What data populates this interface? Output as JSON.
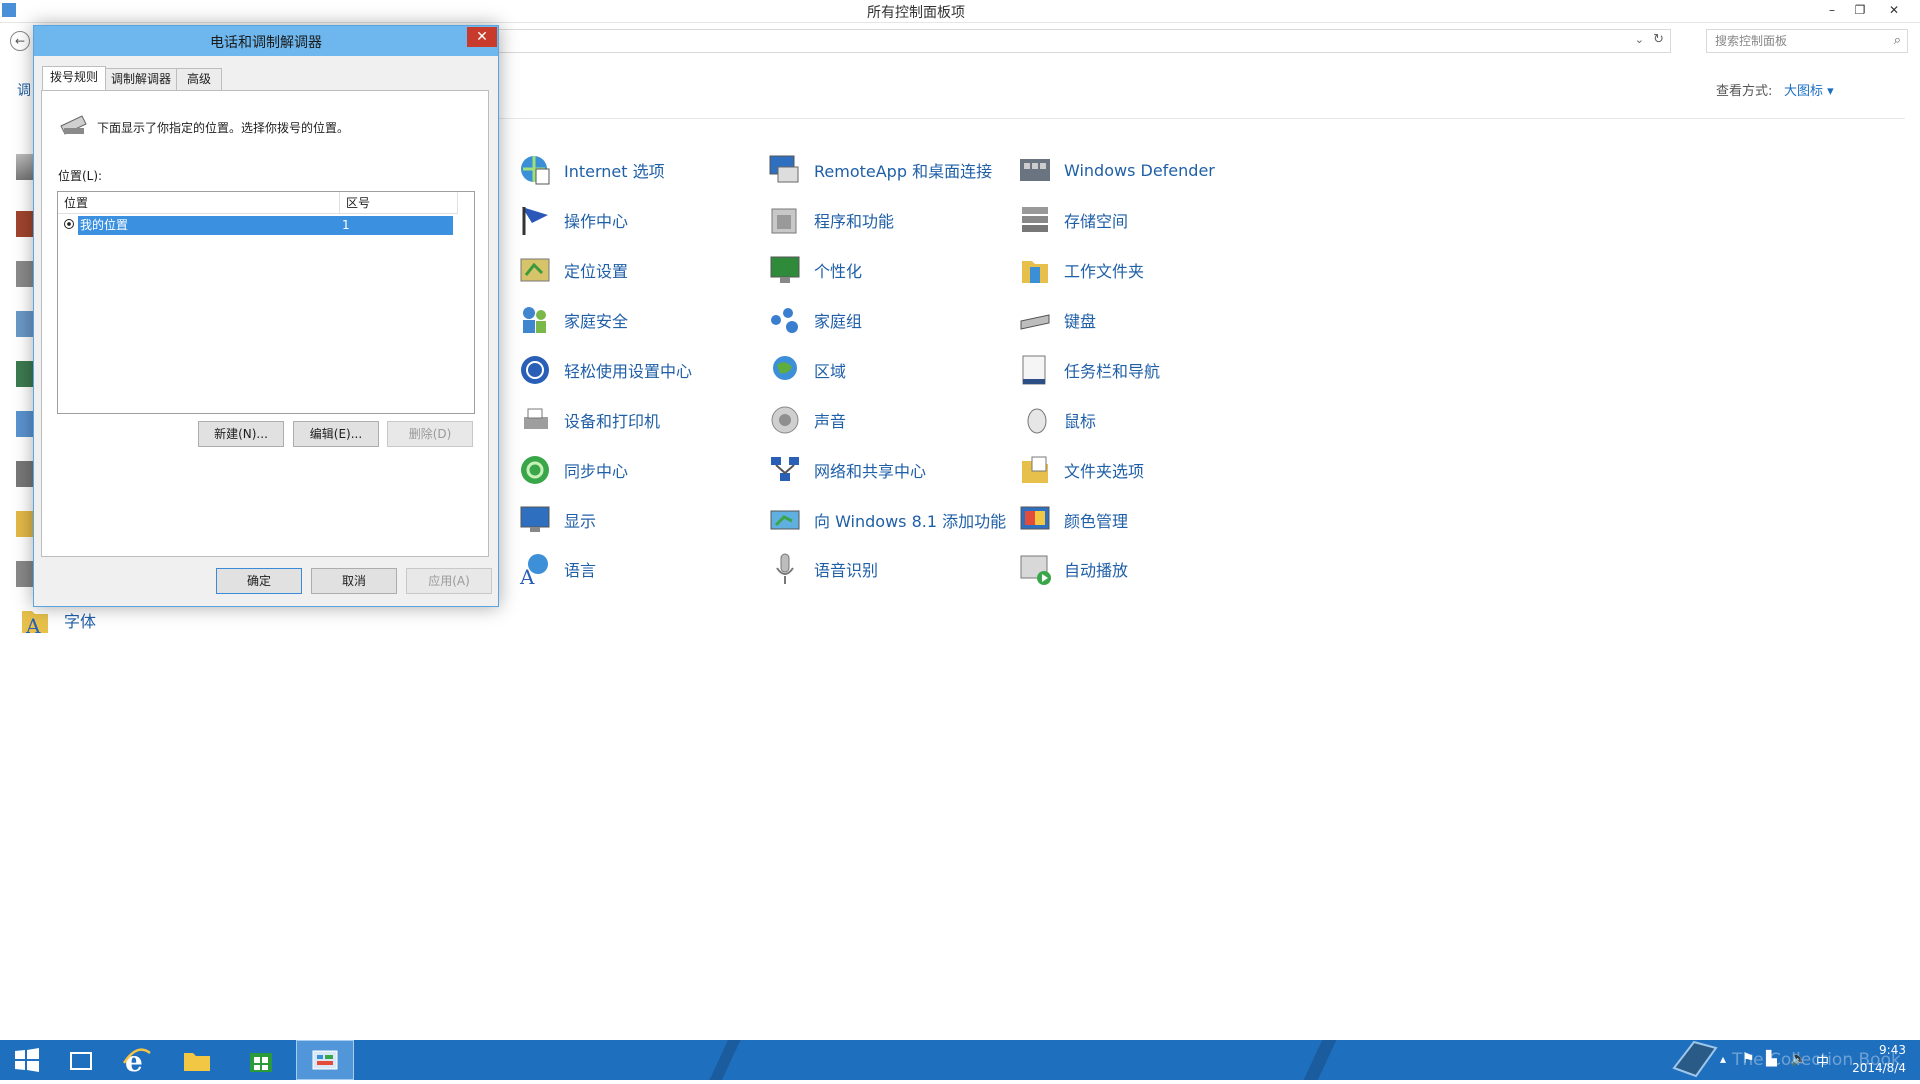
{
  "window": {
    "title": "所有控制面板项",
    "search_placeholder": "搜索控制面板",
    "left_partial_text": "调",
    "view_by_label": "查看方式:",
    "view_mode": "大图标 ▾"
  },
  "items": [
    {
      "label": "Internet 选项",
      "icon": "internet-options-icon"
    },
    {
      "label": "RemoteApp 和桌面连接",
      "icon": "remoteapp-icon"
    },
    {
      "label": "Windows Defender",
      "icon": "windows-defender-icon"
    },
    {
      "label": "操作中心",
      "icon": "action-center-flag-icon"
    },
    {
      "label": "程序和功能",
      "icon": "programs-features-icon"
    },
    {
      "label": "存储空间",
      "icon": "storage-spaces-icon"
    },
    {
      "label": "定位设置",
      "icon": "location-settings-icon"
    },
    {
      "label": "个性化",
      "icon": "personalization-icon"
    },
    {
      "label": "工作文件夹",
      "icon": "work-folders-icon"
    },
    {
      "label": "家庭安全",
      "icon": "family-safety-icon"
    },
    {
      "label": "家庭组",
      "icon": "homegroup-icon"
    },
    {
      "label": "键盘",
      "icon": "keyboard-icon"
    },
    {
      "label": "轻松使用设置中心",
      "icon": "ease-of-access-icon"
    },
    {
      "label": "区域",
      "icon": "region-icon"
    },
    {
      "label": "任务栏和导航",
      "icon": "taskbar-navigation-icon"
    },
    {
      "label": "设备和打印机",
      "icon": "devices-printers-icon"
    },
    {
      "label": "声音",
      "icon": "sound-icon"
    },
    {
      "label": "鼠标",
      "icon": "mouse-icon"
    },
    {
      "label": "同步中心",
      "icon": "sync-center-icon"
    },
    {
      "label": "网络和共享中心",
      "icon": "network-sharing-icon"
    },
    {
      "label": "文件夹选项",
      "icon": "folder-options-icon"
    },
    {
      "label": "显示",
      "icon": "display-icon"
    },
    {
      "label": "向 Windows 8.1 添加功能",
      "icon": "add-features-icon"
    },
    {
      "label": "颜色管理",
      "icon": "color-management-icon"
    },
    {
      "label": "语言",
      "icon": "language-icon"
    },
    {
      "label": "语音识别",
      "icon": "speech-recognition-icon"
    },
    {
      "label": "自动播放",
      "icon": "autoplay-icon"
    },
    {
      "label": "字体",
      "icon": "fonts-icon"
    }
  ],
  "dialog": {
    "title": "电话和调制解调器",
    "tabs": [
      "拨号规则",
      "调制解调器",
      "高级"
    ],
    "description": "下面显示了你指定的位置。选择你拨号的位置。",
    "locations_label": "位置(L):",
    "columns": [
      "位置",
      "区号"
    ],
    "rows": [
      {
        "location": "我的位置",
        "area_code": "1"
      }
    ],
    "buttons": {
      "new": "新建(N)...",
      "edit": "编辑(E)...",
      "delete": "删除(D)"
    },
    "footer": {
      "ok": "确定",
      "cancel": "取消",
      "apply": "应用(A)"
    }
  },
  "taskbar": {
    "time": "9:43",
    "date": "2014/8/4",
    "watermark": "The Collection Book",
    "ime_label": "中"
  },
  "colors": {
    "taskbar": "#1f6fbf",
    "dialog_title": "#6db7ee",
    "selection": "#3b91e0",
    "link": "#1f5fa8"
  }
}
